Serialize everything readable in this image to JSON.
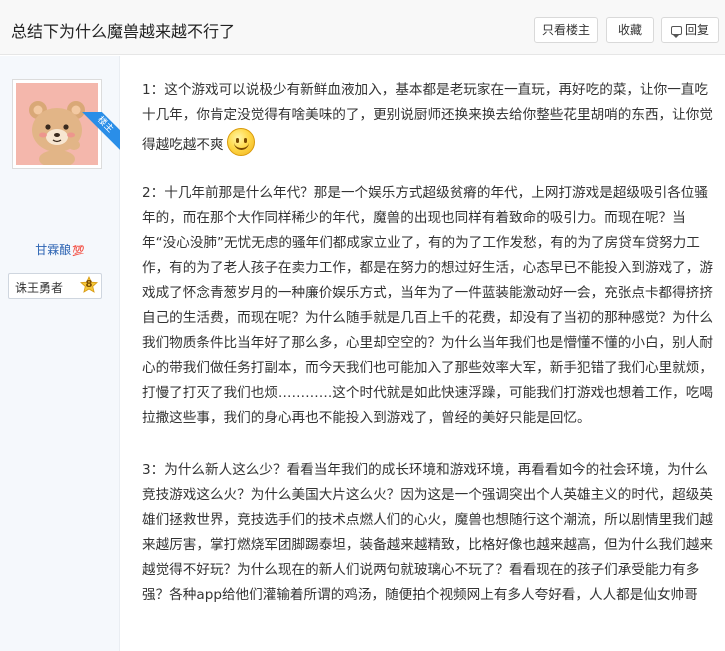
{
  "header": {
    "title": "总结下为什么魔兽越来越不行了",
    "only_op_label": "只看楼主",
    "favorite_label": "收藏",
    "reply_label": "回复"
  },
  "author": {
    "badge": "楼主",
    "username": "甘霖酿",
    "username_badge": "💯",
    "rank_title": "诛王勇者",
    "rank_level": "8"
  },
  "post": {
    "paragraphs": [
      "1：这个游戏可以说极少有新鲜血液加入，基本都是老玩家在一直玩，再好吃的菜，让你一直吃十几年，你肯定没觉得有啥美味的了，更别说厨师还换来换去给你整些花里胡哨的东西，让你觉得越吃越不爽",
      "2：十几年前那是什么年代？那是一个娱乐方式超级贫瘠的年代，上网打游戏是超级吸引各位骚年的，而在那个大作同样稀少的年代，魔兽的出现也同样有着致命的吸引力。而现在呢？当年“没心没肺”无忧无虑的骚年们都成家立业了，有的为了工作发愁，有的为了房贷车贷努力工作，有的为了老人孩子在卖力工作，都是在努力的想过好生活，心态早已不能投入到游戏了，游戏成了怀念青葱岁月的一种廉价娱乐方式，当年为了一件蓝装能激动好一会，充张点卡都得挤挤自己的生活费，而现在呢？为什么随手就是几百上千的花费，却没有了当初的那种感觉？为什么我们物质条件比当年好了那么多，心里却空空的？为什么当年我们也是懵懂不懂的小白，别人耐心的带我们做任务打副本，而今天我们也可能加入了那些效率大军，新手犯错了我们心里就烦，打慢了打灭了我们也烦…………这个时代就是如此快速浮躁，可能我们打游戏也想着工作，吃喝拉撒这些事，我们的身心再也不能投入到游戏了，曾经的美好只能是回忆。",
      "3：为什么新人这么少？看看当年我们的成长环境和游戏环境，再看看如今的社会环境，为什么竞技游戏这么火？为什么美国大片这么火？因为这是一个强调突出个人英雄主义的时代，超级英雄们拯救世界，竞技选手们的技术点燃人们的心火，魔兽也想随行这个潮流，所以剧情里我们越来越厉害，掌打燃烧军团脚踢泰坦，装备越来越精致，比格好像也越来越高，但为什么我们越来越觉得不好玩？为什么现在的新人们说两句就玻璃心不玩了？看看现在的孩子们承受能力有多强？各种app给他们灌输着所谓的鸡汤，随便拍个视频网上有多人夸好看，人人都是仙女帅哥"
    ]
  },
  "icons": {
    "reply": "reply-icon",
    "emoji": "smiley-emoji-icon",
    "level_badge": "level-star-icon",
    "avatar": "bear-avatar"
  }
}
